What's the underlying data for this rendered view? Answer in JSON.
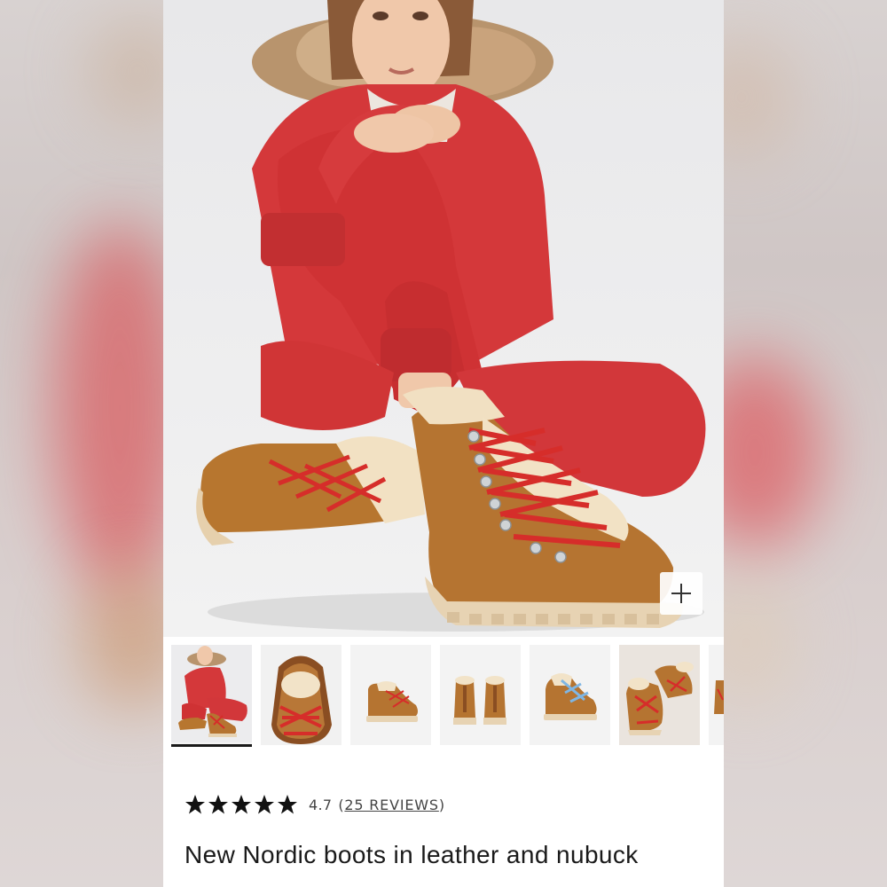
{
  "hero": {
    "image_icon": "product-photo",
    "zoom_icon": "plus-icon"
  },
  "thumbnails": [
    {
      "name": "model-sitting",
      "active": true
    },
    {
      "name": "boot-toe-closeup",
      "active": false
    },
    {
      "name": "boot-side-view",
      "active": false
    },
    {
      "name": "boot-pair-back-view",
      "active": false
    },
    {
      "name": "boot-blue-laces",
      "active": false
    },
    {
      "name": "boot-pair-red-laces",
      "active": false
    },
    {
      "name": "boot-partial",
      "active": false
    }
  ],
  "rating": {
    "stars": 5,
    "value": "4.7",
    "reviews_prefix": "(",
    "reviews_label": "25 REVIEWS",
    "reviews_suffix": ")"
  },
  "product": {
    "title": "New Nordic boots in leather and nubuck"
  },
  "colors": {
    "suit_red": "#d8393a",
    "boot_tan": "#b87737",
    "lace_red": "#d62d2a",
    "sole_cream": "#e7d3b3",
    "shearling": "#f2e3c8",
    "text": "#1a1a1a"
  }
}
